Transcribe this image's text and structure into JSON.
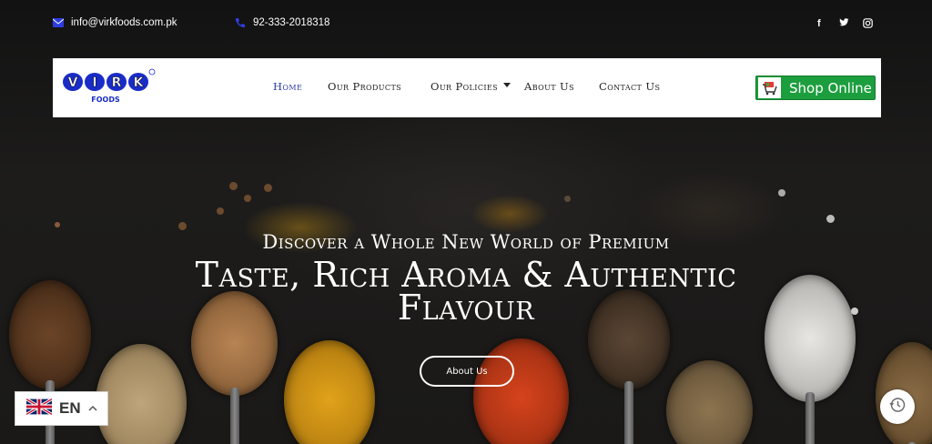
{
  "topbar": {
    "email": "info@virkfoods.com.pk",
    "phone": "92-333-2018318",
    "social_icons": [
      "facebook-icon",
      "twitter-icon",
      "instagram-icon"
    ]
  },
  "logo": {
    "brand": "VIRK",
    "sub": "FOODS"
  },
  "nav": {
    "items": [
      {
        "label": "Home",
        "active": true
      },
      {
        "label": "Our Products"
      },
      {
        "label": "Our Policies",
        "has_dropdown": true
      },
      {
        "label": "About Us"
      },
      {
        "label": "Contact Us"
      }
    ],
    "shop_label": "Shop Online"
  },
  "hero": {
    "subtitle": "Discover a Whole New World of Premium",
    "title_line1": "Taste, Rich Aroma & Authentic",
    "title_line2": "Flavour",
    "button_label": "About Us"
  },
  "language": {
    "code": "EN"
  },
  "colors": {
    "active_nav": "#2c3d9b",
    "shop_green": "#1c9e3e",
    "logo_blue": "#1a2cc7"
  }
}
